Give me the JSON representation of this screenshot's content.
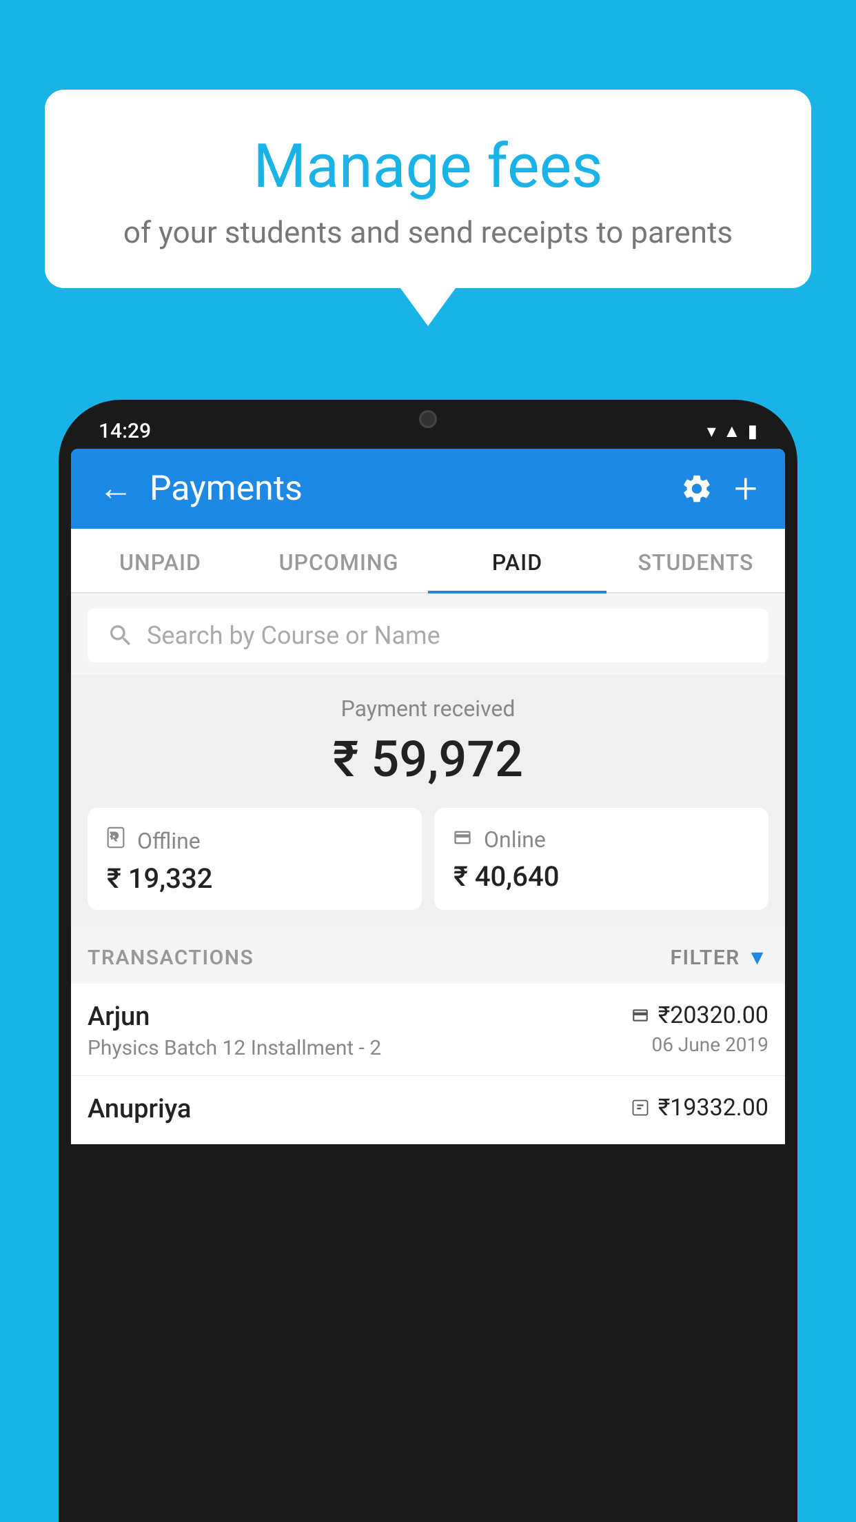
{
  "page": {
    "background_color": "#1ab3e8"
  },
  "speech_bubble": {
    "title": "Manage fees",
    "subtitle": "of your students and send receipts to parents"
  },
  "phone": {
    "time": "14:29",
    "header": {
      "title": "Payments",
      "back_label": "←",
      "plus_label": "+"
    },
    "tabs": [
      {
        "label": "UNPAID",
        "active": false
      },
      {
        "label": "UPCOMING",
        "active": false
      },
      {
        "label": "PAID",
        "active": true
      },
      {
        "label": "STUDENTS",
        "active": false
      }
    ],
    "search": {
      "placeholder": "Search by Course or Name"
    },
    "payment_summary": {
      "received_label": "Payment received",
      "total_amount": "₹ 59,972",
      "offline_label": "Offline",
      "offline_amount": "₹ 19,332",
      "online_label": "Online",
      "online_amount": "₹ 40,640"
    },
    "transactions": {
      "header_label": "TRANSACTIONS",
      "filter_label": "FILTER",
      "rows": [
        {
          "name": "Arjun",
          "detail": "Physics Batch 12 Installment - 2",
          "amount": "₹20320.00",
          "date": "06 June 2019",
          "payment_type": "online"
        },
        {
          "name": "Anupriya",
          "detail": "",
          "amount": "₹19332.00",
          "date": "",
          "payment_type": "offline"
        }
      ]
    }
  }
}
